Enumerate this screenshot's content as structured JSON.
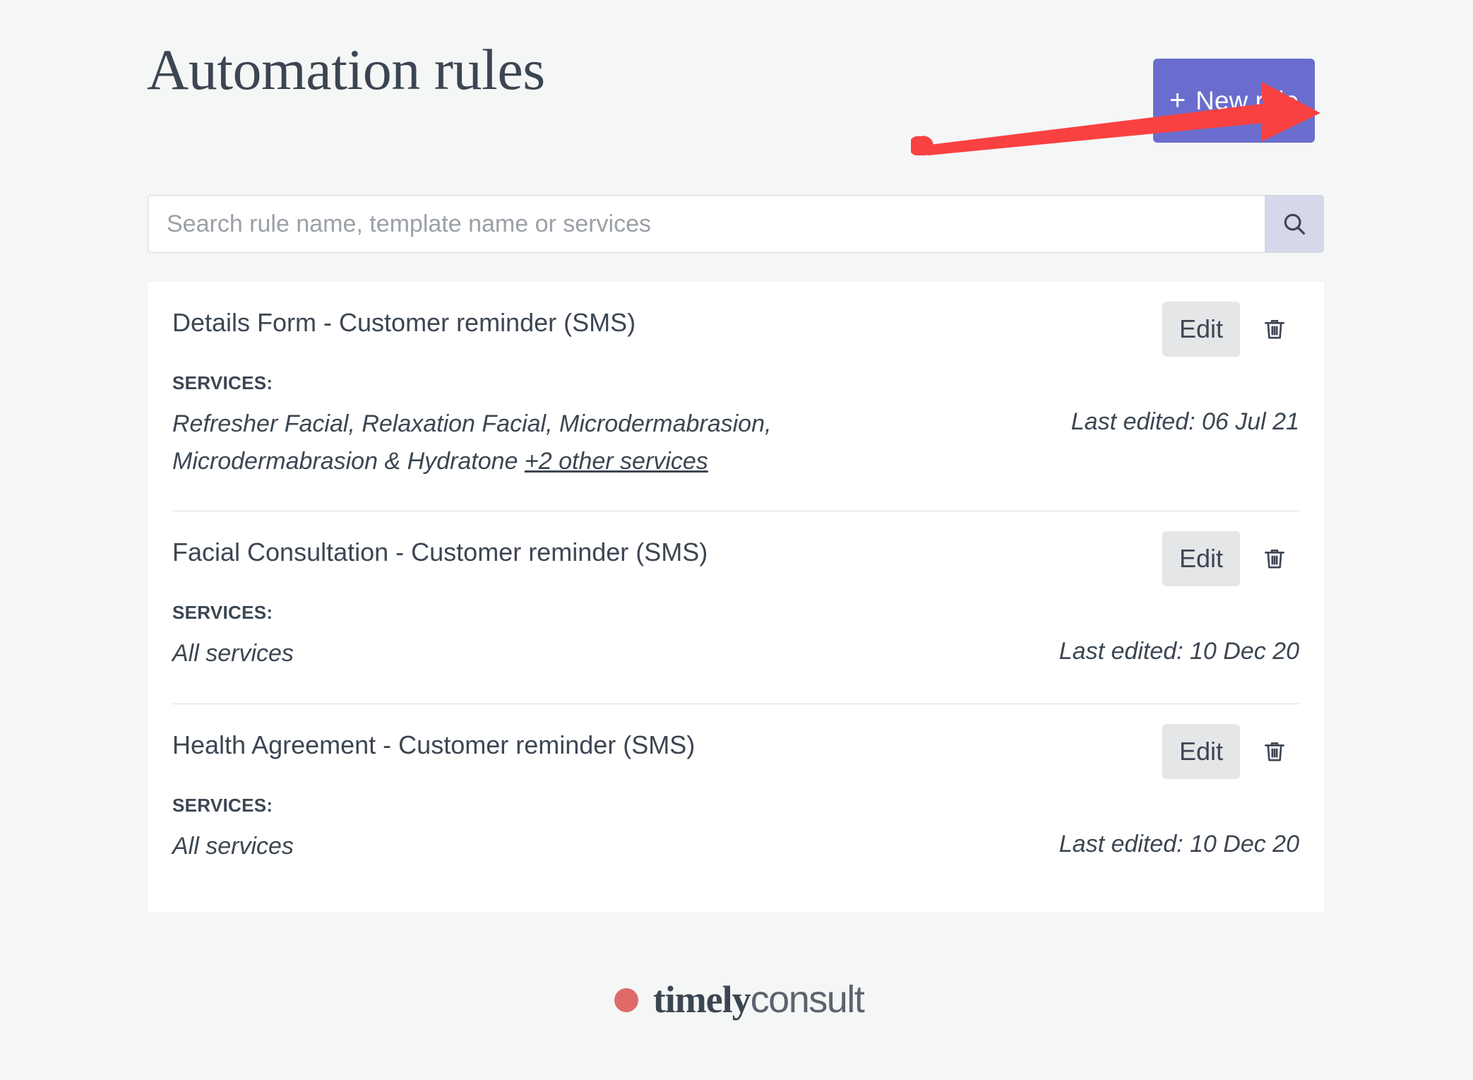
{
  "header": {
    "title": "Automation rules",
    "new_rule_button": {
      "plus": "+",
      "label": "New rule"
    }
  },
  "annotation": {
    "type": "arrow",
    "color": "#fa4141",
    "points_to": "new-rule-button"
  },
  "search": {
    "placeholder": "Search rule name, template name or services",
    "value": "",
    "button_icon": "search-icon"
  },
  "rules": [
    {
      "title": "Details Form - Customer reminder (SMS)",
      "services_label": "SERVICES:",
      "services": "Refresher Facial, Relaxation Facial, Microdermabrasion, Microdermabrasion & Hydratone ",
      "services_more": "+2 other services",
      "last_edited": "Last edited: 06 Jul 21",
      "edit_label": "Edit",
      "delete_icon": "trash-icon"
    },
    {
      "title": "Facial Consultation - Customer reminder (SMS)",
      "services_label": "SERVICES:",
      "services": "All services",
      "services_more": "",
      "last_edited": "Last edited: 10 Dec 20",
      "edit_label": "Edit",
      "delete_icon": "trash-icon"
    },
    {
      "title": "Health Agreement - Customer reminder (SMS)",
      "services_label": "SERVICES:",
      "services": "All services",
      "services_more": "",
      "last_edited": "Last edited: 10 Dec 20",
      "edit_label": "Edit",
      "delete_icon": "trash-icon"
    }
  ],
  "footer": {
    "logo_bold": "timely",
    "logo_light": "consult"
  },
  "colors": {
    "background": "#f5f7f7",
    "accent_purple": "#6a6dcd",
    "search_button": "#d6d7ea",
    "edit_button": "#e5e6e8",
    "text": "#3c4652",
    "annotation_red": "#fa4141",
    "logo_coral": "#e06a6a"
  }
}
